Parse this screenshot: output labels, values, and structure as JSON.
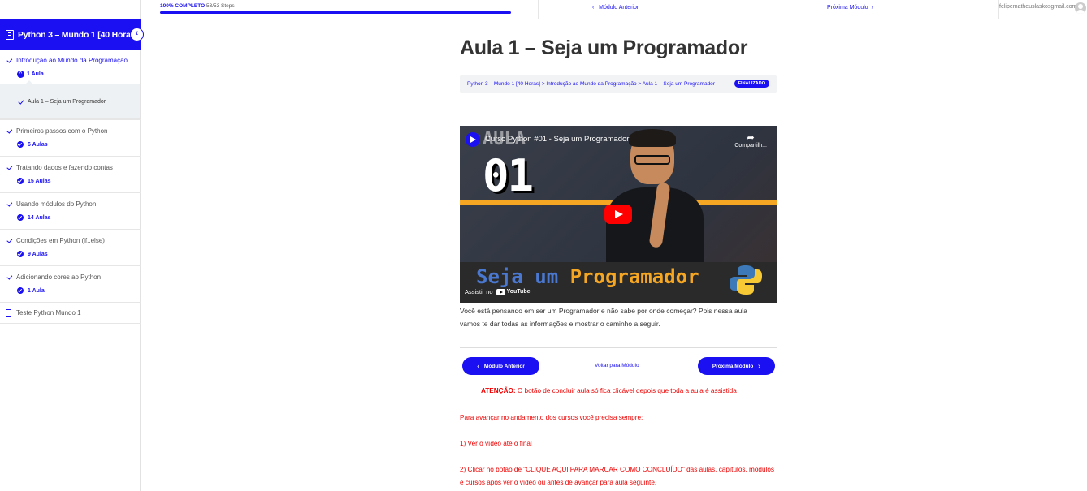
{
  "topbar": {
    "progress_percent": 100,
    "progress_label": "100% COMPLETO",
    "progress_steps": "53/53 Steps",
    "prev_module": "Módulo Anterior",
    "next_module": "Próxima Módulo",
    "user_email": "felipematheuslaskosgmail.com"
  },
  "sidebar": {
    "course_title": "Python 3 – Mundo 1 [40 Horas]",
    "sections": [
      {
        "title": "Introdução ao Mundo da Programação",
        "count": "1 Aula"
      },
      {
        "title": "Primeiros passos com o Python",
        "count": "6 Aulas"
      },
      {
        "title": "Tratando dados e fazendo contas",
        "count": "15 Aulas"
      },
      {
        "title": "Usando módulos do Python",
        "count": "14 Aulas"
      },
      {
        "title": "Condições em Python (if..else)",
        "count": "9 Aulas"
      },
      {
        "title": "Adicionando cores ao Python",
        "count": "1 Aula"
      }
    ],
    "active_lesson": "Aula 1 – Seja um Programador",
    "quiz": "Teste Python Mundo 1"
  },
  "main": {
    "title": "Aula 1 – Seja um Programador",
    "breadcrumb": "Python 3 – Mundo 1 [40 Horas] > Introdução ao Mundo da Programação > Aula 1 – Seja um Programador",
    "status_badge": "FINALIZADO",
    "video": {
      "title": "Curso Python #01 - Seja um Programador",
      "share": "Compartilh...",
      "watch_on": "Assistir no",
      "youtube": "YouTube",
      "thumb_aula": "AULA",
      "thumb_number": "01",
      "thumb_seja": "Seja um",
      "thumb_programador": "Programador"
    },
    "description": "Você está pensando em ser um Programador e não sabe por onde começar? Pois nessa aula vamos te dar todas as informações e mostrar o caminho a seguir.",
    "prev_button": "Módulo Anterior",
    "back_link": "Voltar para Módulo",
    "next_button": "Próxima Módulo",
    "attention_label": "ATENÇÃO:",
    "attention_text": " O botão de concluir aula só fica clicável depois que toda a aula é assistida",
    "advance_text": "Para avançar no andamento dos cursos você precisa sempre:",
    "step1": "1) Ver o vídeo até o final",
    "step2": "2) Clicar no botão de \"CLIQUE AQUI PARA MARCAR COMO CONCLUÍDO\" das aulas, capítulos, módulos e cursos após ver o vídeo ou antes de avançar para aula seguinte."
  },
  "colors": {
    "accent": "#1a10f2",
    "warning": "#e00000"
  }
}
